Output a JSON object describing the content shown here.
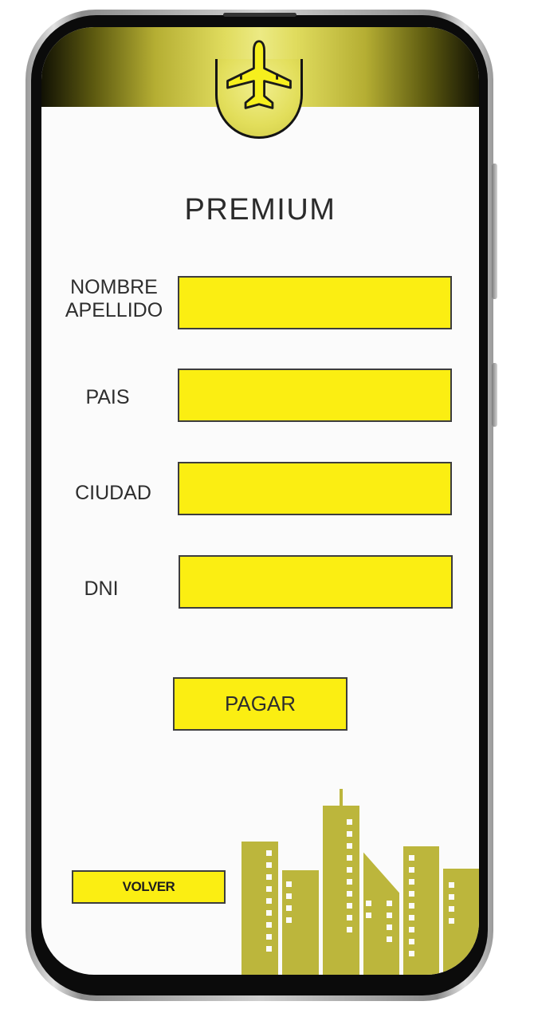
{
  "screen": {
    "title": "PREMIUM"
  },
  "form": {
    "fields": [
      {
        "label_line1": "NOMBRE",
        "label_line2": "APELLIDO",
        "value": ""
      },
      {
        "label": "PAIS",
        "value": ""
      },
      {
        "label": "CIUDAD",
        "value": ""
      },
      {
        "label": "DNI",
        "value": ""
      }
    ],
    "submit_label": "PAGAR"
  },
  "footer": {
    "back_label": "VOLVER"
  },
  "icons": {
    "header": "airplane-icon",
    "footer": "city-skyline-illustration"
  },
  "colors": {
    "accent": "#fbee12",
    "header_gold": "#e2de5b",
    "text": "#2e2e2e",
    "building": "#b8b23a"
  }
}
